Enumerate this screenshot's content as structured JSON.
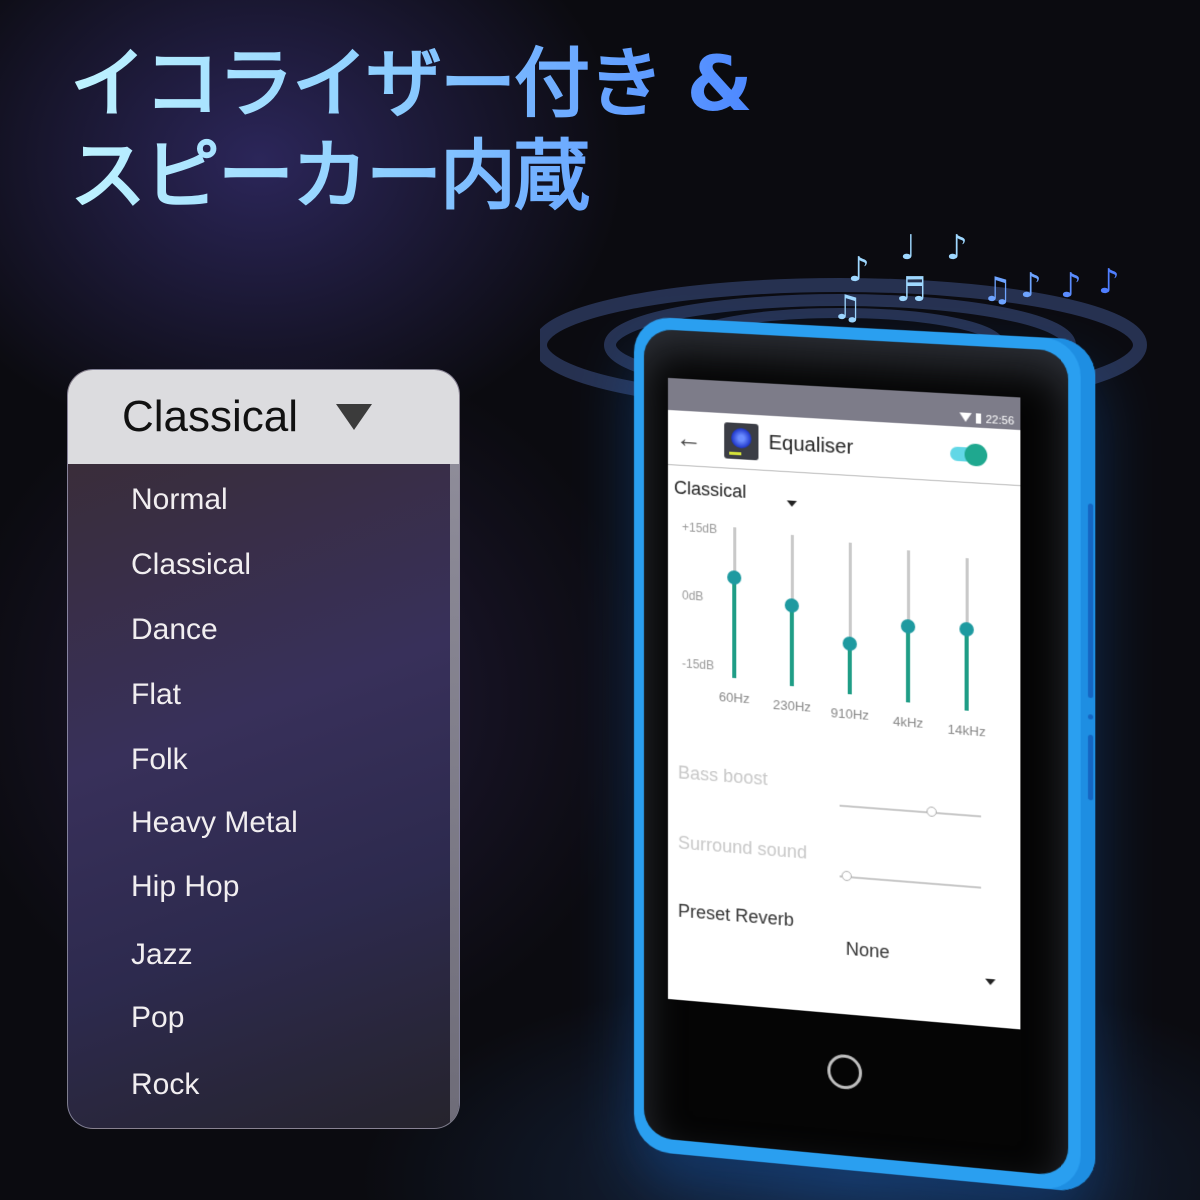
{
  "headline": {
    "line1": "イコライザー付き &",
    "line2": "スピーカー内蔵"
  },
  "preset_dropdown": {
    "selected": "Classical",
    "options": [
      "Normal",
      "Classical",
      "Dance",
      "Flat",
      "Folk",
      "Heavy Metal",
      "Hip Hop",
      "Jazz",
      "Pop",
      "Rock"
    ]
  },
  "notes": [
    "♫",
    "♪",
    "♬",
    "♩",
    "♪",
    "♫",
    "♪",
    "♪",
    "♪"
  ],
  "device": {
    "status_bar": {
      "time": "22:56"
    },
    "app_bar": {
      "title": "Equaliser",
      "enabled": true
    },
    "preset": {
      "value": "Classical"
    },
    "equalizer": {
      "db_max": "+15dB",
      "db_mid": "0dB",
      "db_min": "-15dB",
      "range_db": [
        -15,
        15
      ],
      "bands": [
        {
          "label": "60Hz",
          "gain_db": 5
        },
        {
          "label": "230Hz",
          "gain_db": 1
        },
        {
          "label": "910Hz",
          "gain_db": -5
        },
        {
          "label": "4kHz",
          "gain_db": 0
        },
        {
          "label": "14kHz",
          "gain_db": 1
        }
      ]
    },
    "bass_boost": {
      "label": "Bass boost",
      "value_fraction": 0.65
    },
    "surround_sound": {
      "label": "Surround sound",
      "value_fraction": 0.05
    },
    "preset_reverb": {
      "label": "Preset Reverb",
      "value": "None"
    }
  },
  "colors": {
    "accent_teal": "#1f9d86",
    "device_blue": "#2a9ff0"
  }
}
